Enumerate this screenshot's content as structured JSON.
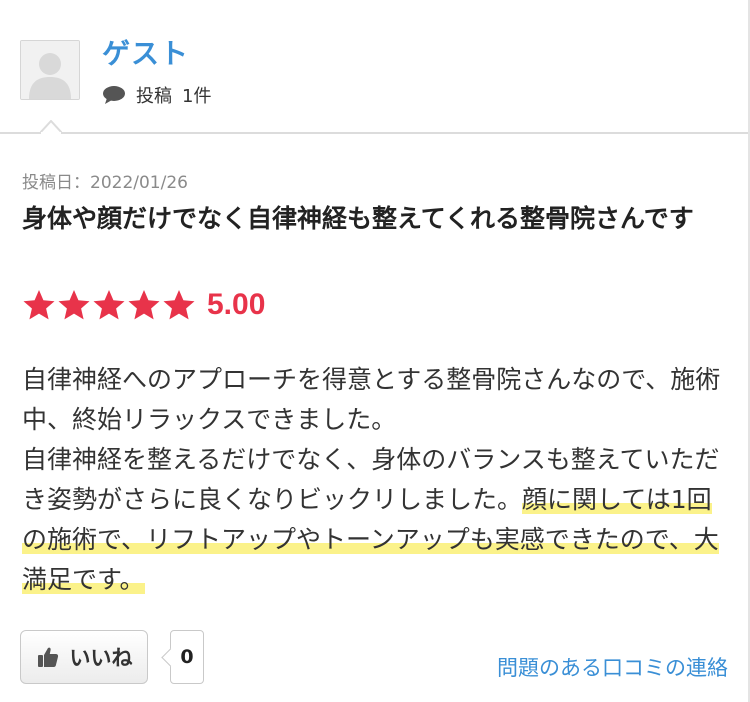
{
  "user": {
    "name": "ゲスト",
    "posts_label": "投稿",
    "posts_count": "1件"
  },
  "review": {
    "date": "投稿日：2022/01/26",
    "title": "身体や顔だけでなく自律神経も整えてくれる整骨院さんです",
    "rating_value": 5,
    "rating_text": "5.00",
    "body_plain": "自律神経へのアプローチを得意とする整骨院さんなので、施術中、終始リラックスできました。\n自律神経を整えるだけでなく、身体のバランスも整えていただき姿勢がさらに良くなりビックリしました。",
    "body_highlight": "顔に関しては1回の施術で、リフトアップやトーンアップも実感できたので、大満足です。"
  },
  "actions": {
    "like_label": "いいね",
    "like_count": "0",
    "report_label": "問題のある口コミの連絡"
  },
  "colors": {
    "accent_blue": "#3a8fd6",
    "star_red": "#e8334a",
    "highlight_yellow": "#fbf28a"
  }
}
